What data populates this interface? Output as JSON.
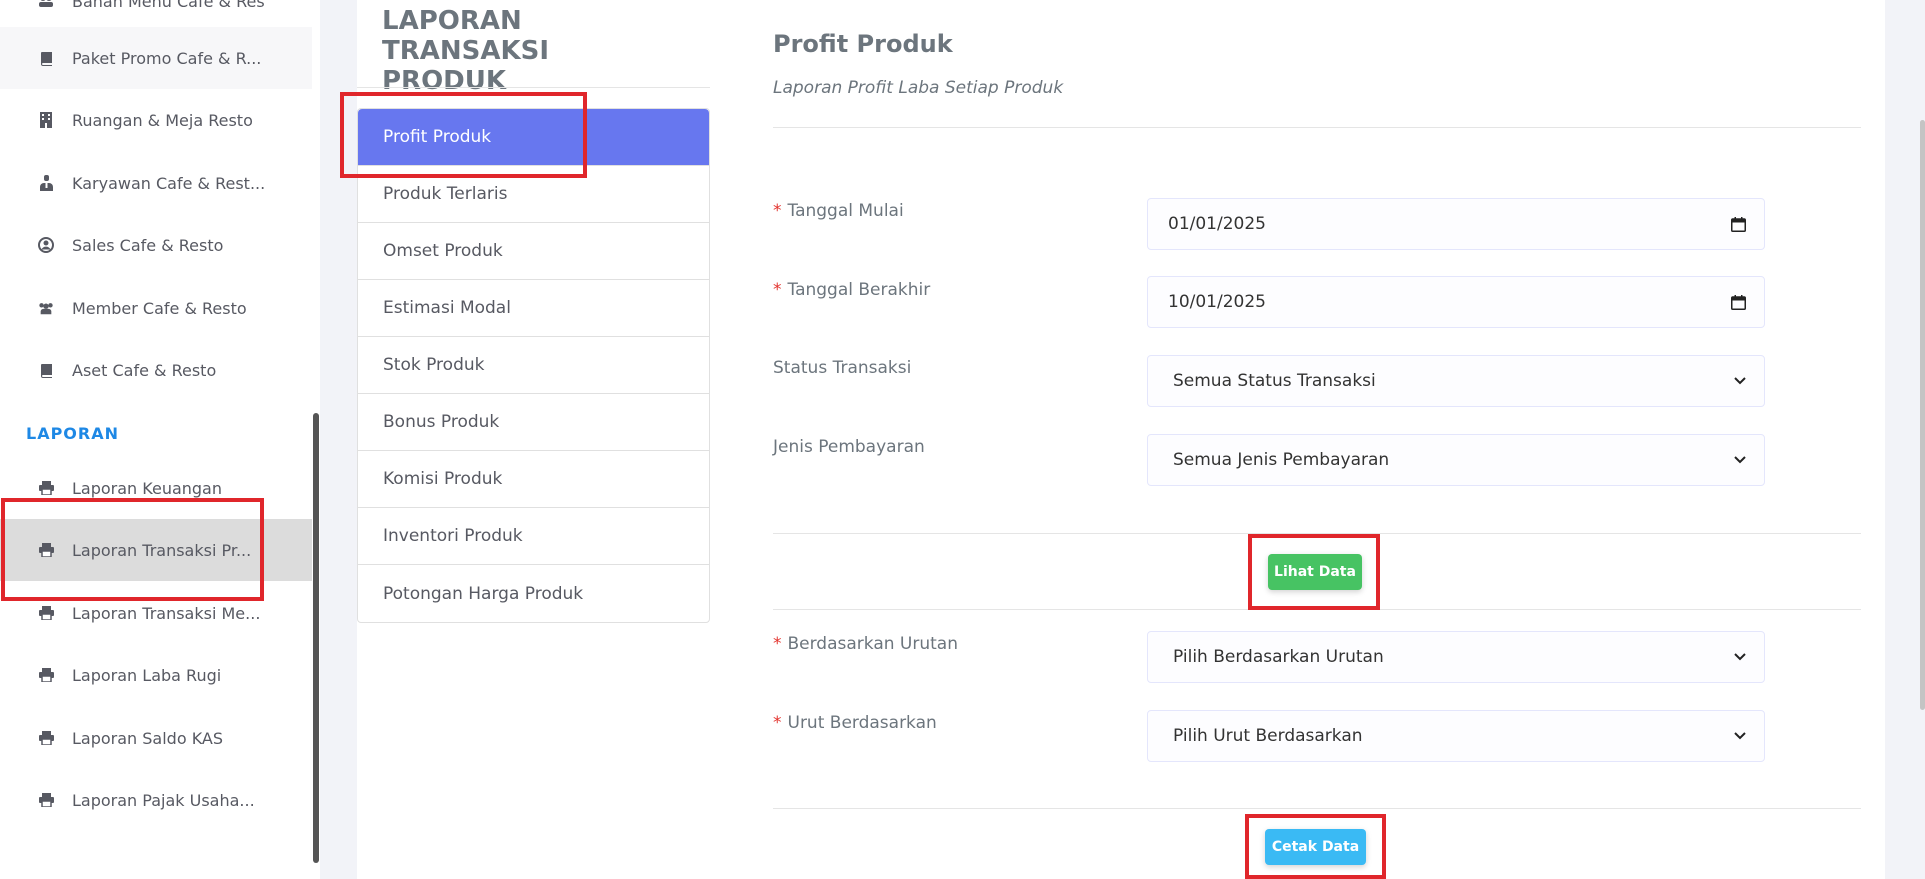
{
  "sidebar": {
    "items_top": [
      {
        "label": "Bahan Menu Cafe & Res",
        "icon": "people-icon"
      },
      {
        "label": "Paket Promo Cafe & R...",
        "icon": "book-icon"
      },
      {
        "label": "Ruangan & Meja Resto",
        "icon": "building-icon"
      },
      {
        "label": "Karyawan Cafe & Rest...",
        "icon": "user-tie-icon"
      },
      {
        "label": "Sales Cafe & Resto",
        "icon": "user-circle-icon"
      },
      {
        "label": "Member Cafe & Resto",
        "icon": "users-icon"
      },
      {
        "label": "Aset Cafe & Resto",
        "icon": "book-icon"
      }
    ],
    "section_label": "LAPORAN",
    "items_report": [
      {
        "label": "Laporan Keuangan",
        "icon": "print-icon"
      },
      {
        "label": "Laporan Transaksi Pr...",
        "icon": "print-icon"
      },
      {
        "label": "Laporan Transaksi Me...",
        "icon": "print-icon"
      },
      {
        "label": "Laporan Laba Rugi",
        "icon": "print-icon"
      },
      {
        "label": "Laporan Saldo KAS",
        "icon": "print-icon"
      },
      {
        "label": "Laporan Pajak Usaha...",
        "icon": "print-icon"
      }
    ]
  },
  "menu": {
    "title": "LAPORAN TRANSAKSI PRODUK",
    "items": [
      "Profit Produk",
      "Produk Terlaris",
      "Omset Produk",
      "Estimasi Modal",
      "Stok Produk",
      "Bonus Produk",
      "Komisi Produk",
      "Inventori Produk",
      "Potongan Harga Produk"
    ]
  },
  "form": {
    "title": "Profit Produk",
    "subtitle": "Laporan Profit Laba Setiap Produk",
    "required_mark": "*",
    "start_date": {
      "label": "Tanggal Mulai",
      "value": "01/01/2025"
    },
    "end_date": {
      "label": "Tanggal Berakhir",
      "value": "10/01/2025"
    },
    "status": {
      "label": "Status Transaksi",
      "value": "Semua Status Transaksi"
    },
    "payment": {
      "label": "Jenis Pembayaran",
      "value": "Semua Jenis Pembayaran"
    },
    "view_button": "Lihat Data",
    "order_by": {
      "label": "Berdasarkan Urutan",
      "value": "Pilih Berdasarkan Urutan"
    },
    "sort_by": {
      "label": "Urut Berdasarkan",
      "value": "Pilih Urut Berdasarkan"
    },
    "print_button": "Cetak Data"
  },
  "colors": {
    "accent": "#6777ef",
    "success": "#47c363",
    "info": "#3abaf4",
    "highlight": "#e0262b",
    "section": "#1e88e5"
  }
}
